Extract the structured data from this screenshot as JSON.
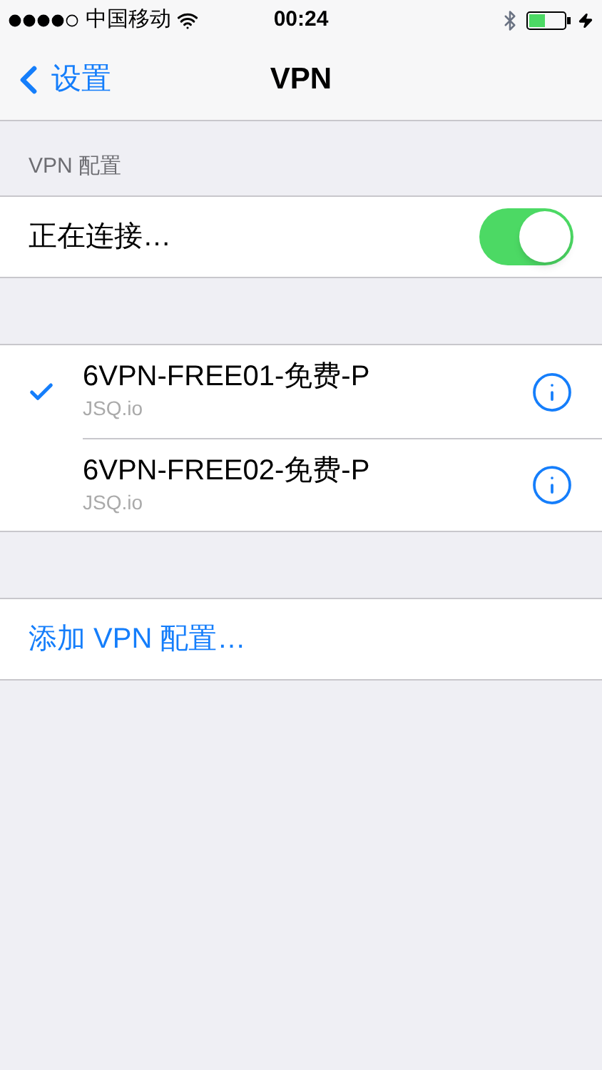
{
  "status_bar": {
    "carrier": "中国移动",
    "time": "00:24"
  },
  "nav": {
    "back": "设置",
    "title": "VPN"
  },
  "section_header": "VPN 配置",
  "status_row": {
    "label": "正在连接…",
    "on": true
  },
  "configs": [
    {
      "name": "6VPN-FREE01-免费-P",
      "server": "JSQ.io",
      "selected": true
    },
    {
      "name": "6VPN-FREE02-免费-P",
      "server": "JSQ.io",
      "selected": false
    }
  ],
  "add_config": "添加 VPN 配置…"
}
